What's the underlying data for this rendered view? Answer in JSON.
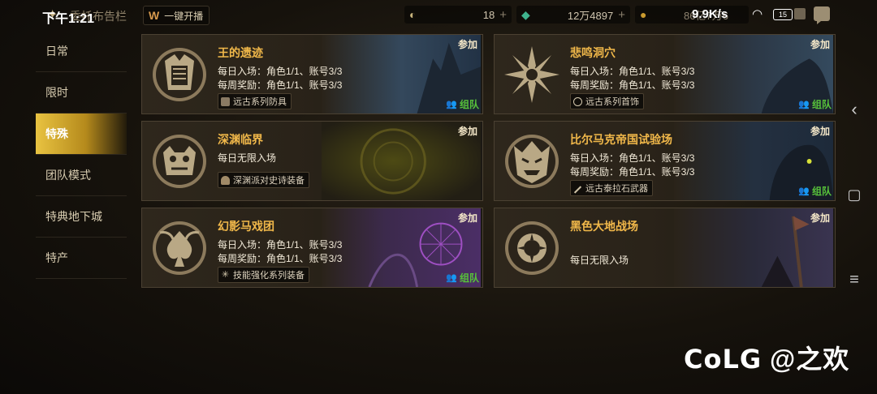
{
  "status_bar": {
    "time": "下午1:21",
    "network_speed": "9.9K/s",
    "battery": "15"
  },
  "header": {
    "title": "委托布告栏",
    "broadcast_label": "一键开播",
    "currencies": [
      {
        "icon": "coin-c-icon",
        "value": "18",
        "color": "#c8b47c"
      },
      {
        "icon": "green-crystal-icon",
        "value": "12万4897",
        "color": "#3fb38e"
      },
      {
        "icon": "gold-coin-icon",
        "value": "86亿7万6",
        "color": "#c99a2e"
      }
    ]
  },
  "sidebar": {
    "items": [
      {
        "label": "日常",
        "active": false
      },
      {
        "label": "限时",
        "active": false
      },
      {
        "label": "特殊",
        "active": true
      },
      {
        "label": "团队模式",
        "active": false
      },
      {
        "label": "特典地下城",
        "active": false
      },
      {
        "label": "特产",
        "active": false
      }
    ]
  },
  "cards": [
    {
      "name": "王的遗迹",
      "line1": "每日入场：角色1/1、账号3/3",
      "line2": "每周奖励：角色1/1、账号3/3",
      "tag": "远古系列防具",
      "join": "参加",
      "team": "组队",
      "emblem": "ruins-emblem-icon"
    },
    {
      "name": "悲鸣洞穴",
      "line1": "每日入场：角色1/1、账号3/3",
      "line2": "每周奖励：角色1/1、账号3/3",
      "tag": "远古系列首饰",
      "join": "参加",
      "team": "组队",
      "emblem": "flower-emblem-icon"
    },
    {
      "name": "深渊临界",
      "line1": "每日无限入场",
      "line2": "",
      "tag": "深渊派对史诗装备",
      "join": "参加",
      "team": "",
      "emblem": "demon-face-emblem-icon"
    },
    {
      "name": "比尔马克帝国试验场",
      "line1": "每日入场：角色1/1、账号3/3",
      "line2": "每周奖励：角色1/1、账号3/3",
      "tag": "远古泰拉石武器",
      "join": "参加",
      "team": "组队",
      "emblem": "beast-mask-emblem-icon"
    },
    {
      "name": "幻影马戏团",
      "line1": "每日入场：角色1/1、账号3/3",
      "line2": "每周奖励：角色1/1、账号3/3",
      "tag": "技能强化系列装备",
      "join": "参加",
      "team": "组队",
      "emblem": "jester-spade-emblem-icon"
    },
    {
      "name": "黑色大地战场",
      "line1": "每日无限入场",
      "line2": "",
      "tag": "",
      "join": "参加",
      "team": "",
      "emblem": "dark-sun-emblem-icon"
    }
  ],
  "watermark": {
    "brand": "CoLG",
    "handle": "@之欢"
  }
}
